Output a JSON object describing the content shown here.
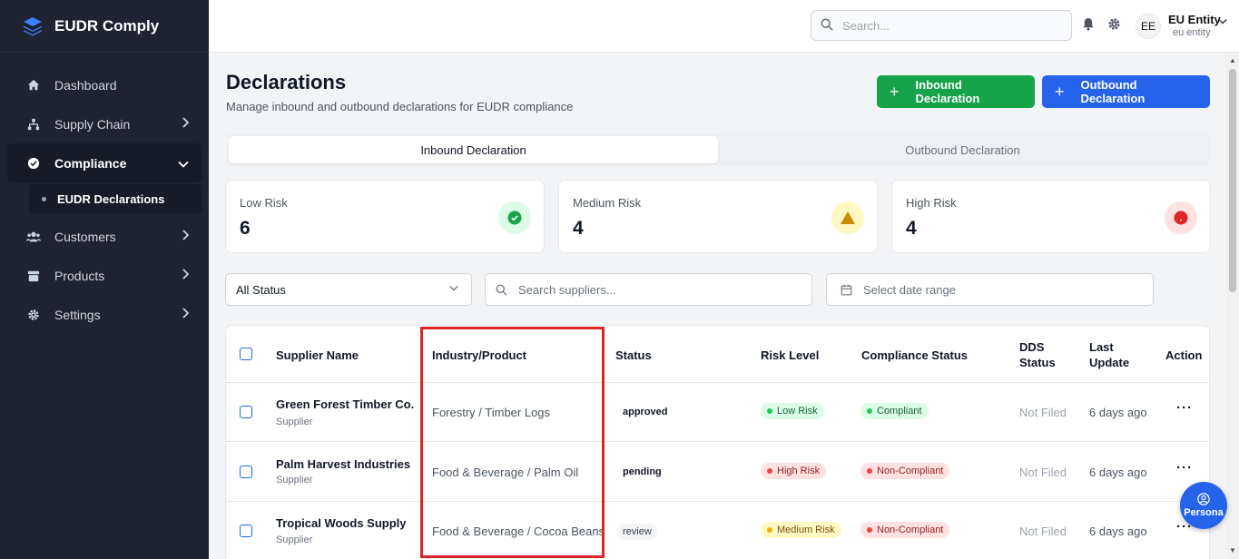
{
  "app": {
    "name": "EUDR Comply"
  },
  "sidebar": {
    "items": [
      {
        "label": "Dashboard"
      },
      {
        "label": "Supply Chain"
      },
      {
        "label": "Compliance"
      },
      {
        "label": "Customers"
      },
      {
        "label": "Products"
      },
      {
        "label": "Settings"
      }
    ],
    "sub_item": "EUDR Declarations"
  },
  "topbar": {
    "search_placeholder": "Search...",
    "avatar_initials": "EE",
    "user_name": "EU Entity",
    "user_role": "eu entity"
  },
  "page": {
    "title": "Declarations",
    "subtitle": "Manage inbound and outbound declarations for EUDR compliance",
    "inbound_button": "Inbound Declaration",
    "outbound_button": "Outbound Declaration"
  },
  "tabs": [
    {
      "label": "Inbound Declaration",
      "active": true
    },
    {
      "label": "Outbound Declaration",
      "active": false
    }
  ],
  "risk_cards": [
    {
      "label": "Low Risk",
      "value": "6",
      "color": "#16a34a"
    },
    {
      "label": "Medium Risk",
      "value": "4",
      "color": "#ca8a04"
    },
    {
      "label": "High Risk",
      "value": "4",
      "color": "#dc2626"
    }
  ],
  "filters": {
    "status": "All Status",
    "search_placeholder": "Search suppliers...",
    "date_placeholder": "Select date range"
  },
  "table": {
    "headers": {
      "supplier": "Supplier Name",
      "industry": "Industry/Product",
      "status": "Status",
      "risk": "Risk Level",
      "compliance": "Compliance Status",
      "dds_line1": "DDS",
      "dds_line2": "Status",
      "update_line1": "Last",
      "update_line2": "Update",
      "action": "Action"
    },
    "rows": [
      {
        "name": "Green Forest Timber Co.",
        "type": "Supplier",
        "industry": "Forestry / Timber Logs",
        "status": "approved",
        "risk": "Low Risk",
        "compliance": "Compliant",
        "dds": "Not Filed",
        "updated": "6 days ago"
      },
      {
        "name": "Palm Harvest Industries",
        "type": "Supplier",
        "industry": "Food & Beverage / Palm Oil",
        "status": "pending",
        "risk": "High Risk",
        "compliance": "Non-Compliant",
        "dds": "Not Filed",
        "updated": "6 days ago"
      },
      {
        "name": "Tropical Woods Supply",
        "type": "Supplier",
        "industry": "Food & Beverage / Cocoa Beans",
        "status": "review",
        "risk": "Medium Risk",
        "compliance": "Non-Compliant",
        "dds": "Not Filed",
        "updated": "6 days ago"
      }
    ]
  },
  "persona_button": "Persona"
}
